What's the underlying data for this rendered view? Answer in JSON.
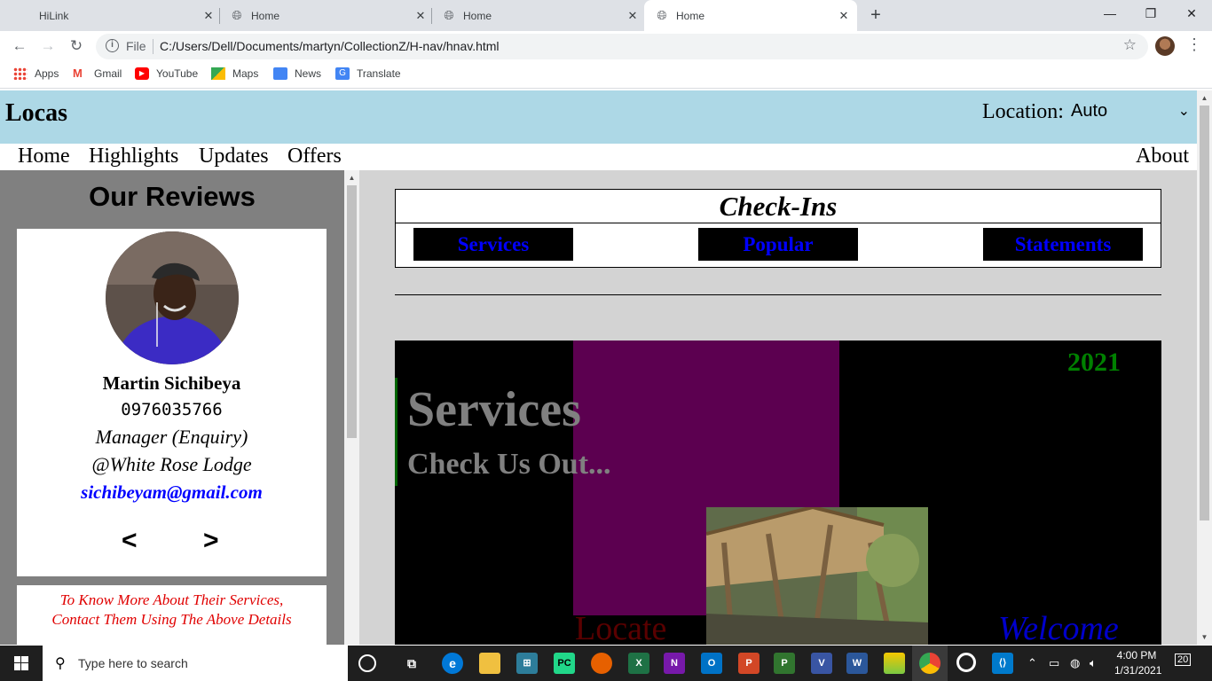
{
  "browser": {
    "tabs": [
      {
        "title": "HiLink",
        "active": false
      },
      {
        "title": "Home",
        "active": false
      },
      {
        "title": "Home",
        "active": false
      },
      {
        "title": "Home",
        "active": true
      }
    ],
    "new_tab": "+",
    "window_controls": {
      "minimize": "—",
      "restore": "❐",
      "close": "✕"
    },
    "address": {
      "scheme_label": "File",
      "url": "C:/Users/Dell/Documents/martyn/CollectionZ/H-nav/hnav.html"
    },
    "bookmarks": [
      "Apps",
      "Gmail",
      "YouTube",
      "Maps",
      "News",
      "Translate"
    ]
  },
  "site": {
    "brand": "Locas",
    "location_label": "Location:",
    "location_value": "Auto",
    "nav": {
      "left": [
        "Home",
        "Highlights",
        "Updates",
        "Offers"
      ],
      "right": "About"
    },
    "reviews": {
      "title": "Our Reviews",
      "name": "Martin Sichibeya",
      "phone": "0976035766",
      "role": "Manager (Enquiry)",
      "place": "@White Rose Lodge",
      "email": "sichibeyam@gmail.com",
      "prev": "<",
      "next": ">",
      "contact_line1": "To Know More About Their Services,",
      "contact_line2": "Contact Them Using The Above Details"
    },
    "checkins": {
      "title": "Check-Ins",
      "buttons": [
        "Services",
        "Popular",
        "Statements"
      ]
    },
    "hero": {
      "year": "2021",
      "title": "Services",
      "subtitle": "Check Us Out...",
      "locate": "Locate",
      "welcome": "Welcome"
    }
  },
  "taskbar": {
    "search_placeholder": "Type here to search",
    "time": "4:00 PM",
    "date": "1/31/2021",
    "notifications": "20"
  }
}
